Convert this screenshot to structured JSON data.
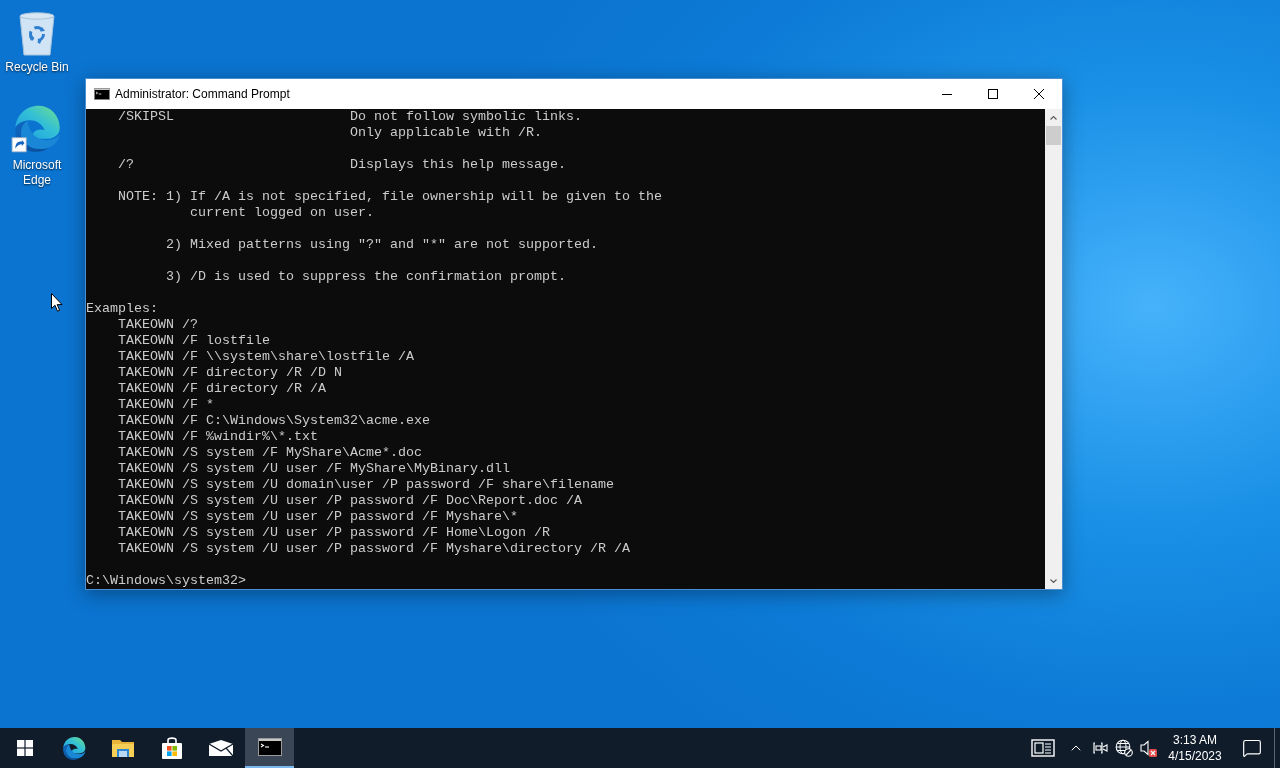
{
  "desktop_icons": [
    {
      "kind": "recycle_bin",
      "label": "Recycle Bin"
    },
    {
      "kind": "browser_shortcut",
      "label": "Microsoft Edge"
    }
  ],
  "window": {
    "title": "Administrator: Command Prompt",
    "console": {
      "options": [
        {
          "parameter": "/SKIPSL",
          "lines": [
            "Do not follow symbolic links.",
            "Only applicable with /R."
          ]
        },
        {
          "parameter": "/?",
          "lines": [
            "Displays this help message."
          ]
        }
      ],
      "notes": [
        {
          "label": "NOTE:",
          "number": "1)",
          "lines": [
            "If /A is not specified, file ownership will be given to the",
            "current logged on user."
          ]
        },
        {
          "number": "2)",
          "lines": [
            "Mixed patterns using \"?\" and \"*\" are not supported."
          ]
        },
        {
          "number": "3)",
          "lines": [
            "/D is used to suppress the confirmation prompt."
          ]
        }
      ],
      "examples_heading": "Examples:",
      "examples": [
        "TAKEOWN /?",
        "TAKEOWN /F lostfile",
        "TAKEOWN /F \\\\system\\share\\lostfile /A",
        "TAKEOWN /F directory /R /D N",
        "TAKEOWN /F directory /R /A",
        "TAKEOWN /F *",
        "TAKEOWN /F C:\\Windows\\System32\\acme.exe",
        "TAKEOWN /F %windir%\\*.txt",
        "TAKEOWN /S system /F MyShare\\Acme*.doc",
        "TAKEOWN /S system /U user /F MyShare\\MyBinary.dll",
        "TAKEOWN /S system /U domain\\user /P password /F share\\filename",
        "TAKEOWN /S system /U user /P password /F Doc\\Report.doc /A",
        "TAKEOWN /S system /U user /P password /F Myshare\\*",
        "TAKEOWN /S system /U user /P password /F Home\\Logon /R",
        "TAKEOWN /S system /U user /P password /F Myshare\\directory /R /A"
      ],
      "prompt": "C:\\Windows\\system32>"
    }
  },
  "taskbar": {
    "apps": [
      {
        "kind": "browser",
        "active": false
      },
      {
        "kind": "explorer",
        "active": false
      },
      {
        "kind": "store",
        "active": false
      },
      {
        "kind": "mail",
        "active": false
      },
      {
        "kind": "terminal",
        "active": true
      }
    ],
    "tray": {
      "network_connected": false,
      "volume_muted": true,
      "time": "3:13 AM",
      "date": "4/15/2023"
    }
  }
}
